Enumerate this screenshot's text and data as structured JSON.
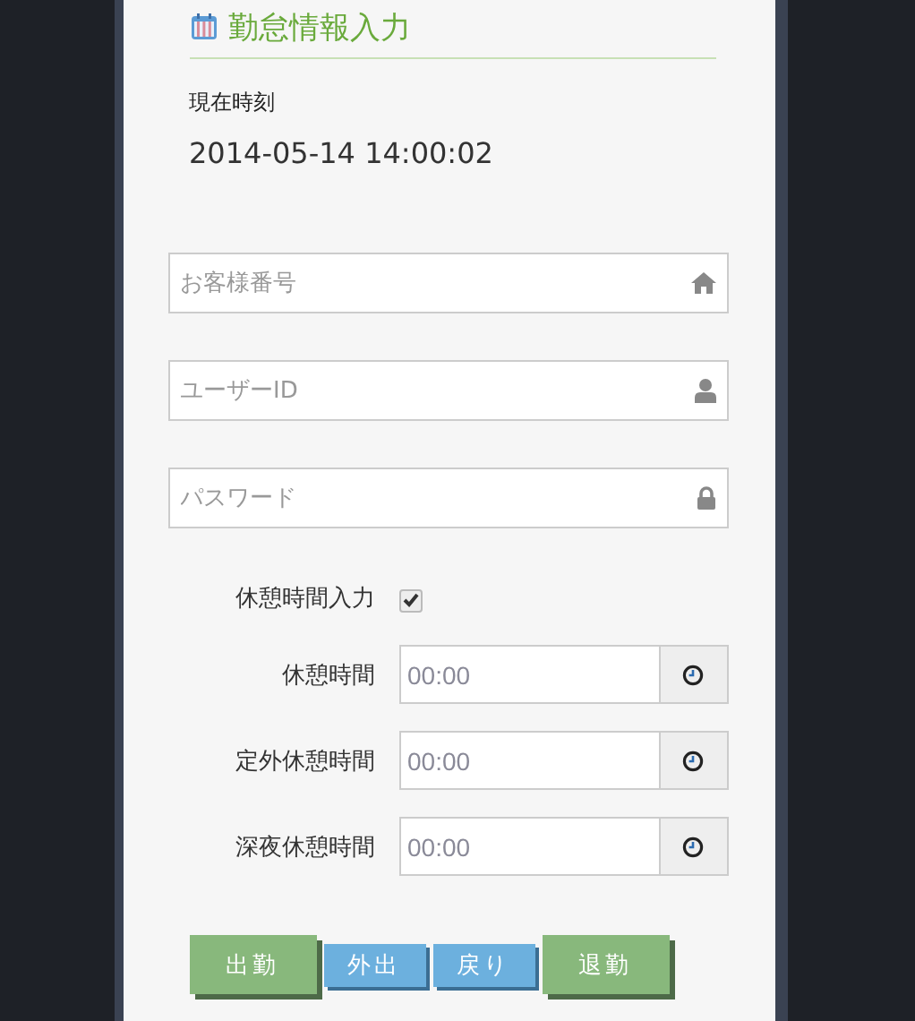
{
  "header": {
    "title": "勤怠情報入力"
  },
  "clock": {
    "label": "現在時刻",
    "value": "2014-05-14 14:00:02"
  },
  "login_fields": [
    {
      "kind": "home",
      "placeholder": "お客様番号"
    },
    {
      "kind": "user",
      "placeholder": "ユーザーID"
    },
    {
      "kind": "lock",
      "placeholder": "パスワード"
    }
  ],
  "break_input": {
    "label": "休憩時間入力",
    "checked": true
  },
  "break_fields": [
    {
      "label": "休憩時間",
      "placeholder": "00:00"
    },
    {
      "label": "定外休憩時間",
      "placeholder": "00:00"
    },
    {
      "label": "深夜休憩時間",
      "placeholder": "00:00"
    }
  ],
  "buttons": [
    {
      "label": "出勤",
      "kind": "large"
    },
    {
      "label": "外出",
      "kind": "small"
    },
    {
      "label": "戻り",
      "kind": "small"
    },
    {
      "label": "退勤",
      "kind": "large"
    }
  ]
}
